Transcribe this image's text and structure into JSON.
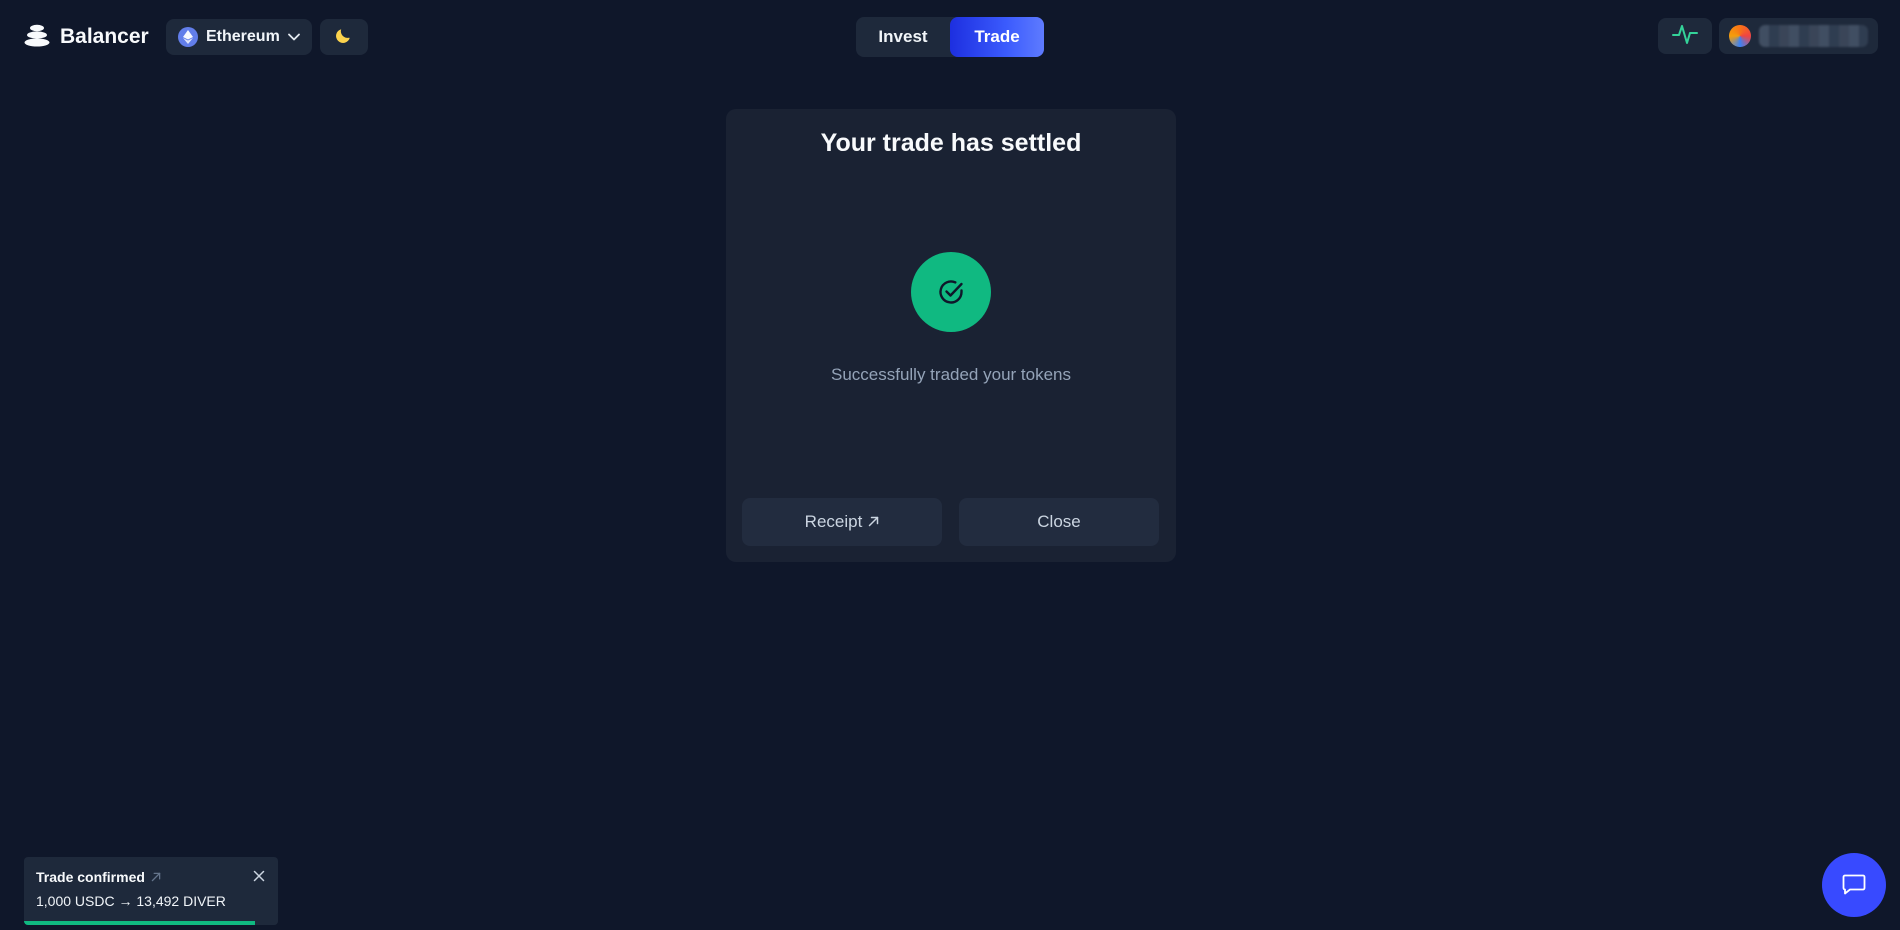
{
  "header": {
    "brand_name": "Balancer",
    "network": {
      "label": "Ethereum",
      "icon": "ethereum-icon"
    },
    "theme_icon": "moon-icon",
    "tabs": [
      {
        "label": "Invest",
        "active": false
      },
      {
        "label": "Trade",
        "active": true
      }
    ],
    "activity_icon": "activity-pulse-icon",
    "account": {
      "avatar_icon": "avatar",
      "address": ""
    }
  },
  "modal": {
    "title": "Your trade has settled",
    "status_icon": "check-circle-icon",
    "message": "Successfully traded your tokens",
    "receipt_label": "Receipt",
    "close_label": "Close"
  },
  "toast": {
    "title": "Trade confirmed",
    "body": "1,000 USDC → 13,492 DIVER",
    "progress": 0.91
  },
  "chat": {
    "icon": "chat-bubble-icon"
  },
  "colors": {
    "background": "#0f172a",
    "surface": "#1e293b",
    "accent": "#384aff",
    "success": "#10b981"
  }
}
